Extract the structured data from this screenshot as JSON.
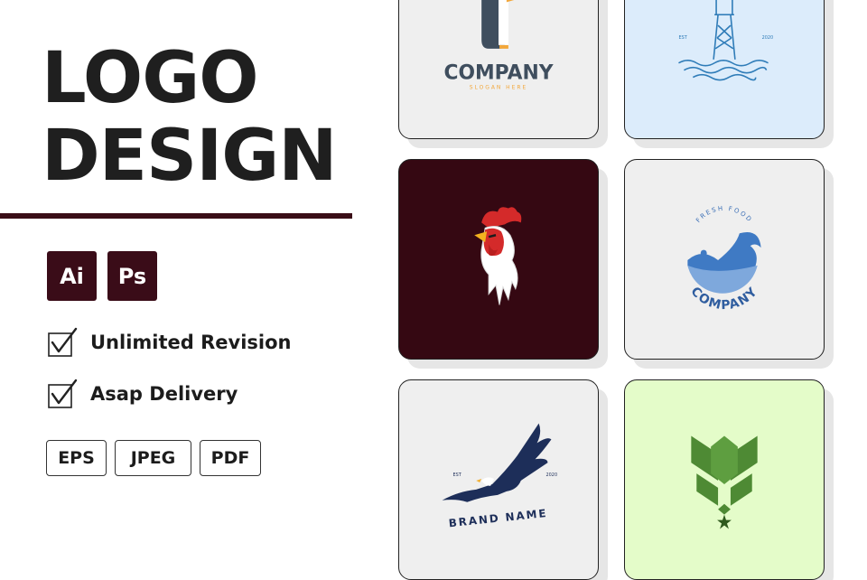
{
  "title": {
    "line1": "LOGO",
    "line2": "DESIGN"
  },
  "apps": [
    {
      "label": "Ai"
    },
    {
      "label": "Ps"
    }
  ],
  "features": [
    {
      "label": "Unlimited Revision"
    },
    {
      "label": "Asap Delivery"
    }
  ],
  "formats": [
    {
      "label": "EPS"
    },
    {
      "label": "JPEG"
    },
    {
      "label": "PDF"
    }
  ],
  "cards": {
    "penguin": {
      "name": "COMPANY",
      "tagline": "SLOGAN HERE",
      "background": "#efefef"
    },
    "lighthouse": {
      "left_text": "EST",
      "right_text": "2020",
      "background": "#dcecfb"
    },
    "rooster": {
      "background": "#350812"
    },
    "wave": {
      "top_text": "FRESH FOOD",
      "bottom_text": "COMPANY",
      "background": "#efefef"
    },
    "eagle": {
      "left_text": "EST",
      "right_text": "2020",
      "name": "BRAND NAME",
      "background": "#efefef"
    },
    "leaf": {
      "background": "#e4fcc9"
    }
  },
  "colors": {
    "brand_dark": "#3a0c18",
    "accent_blue": "#3b6fb6",
    "leaf_green": "#4e8a34"
  }
}
